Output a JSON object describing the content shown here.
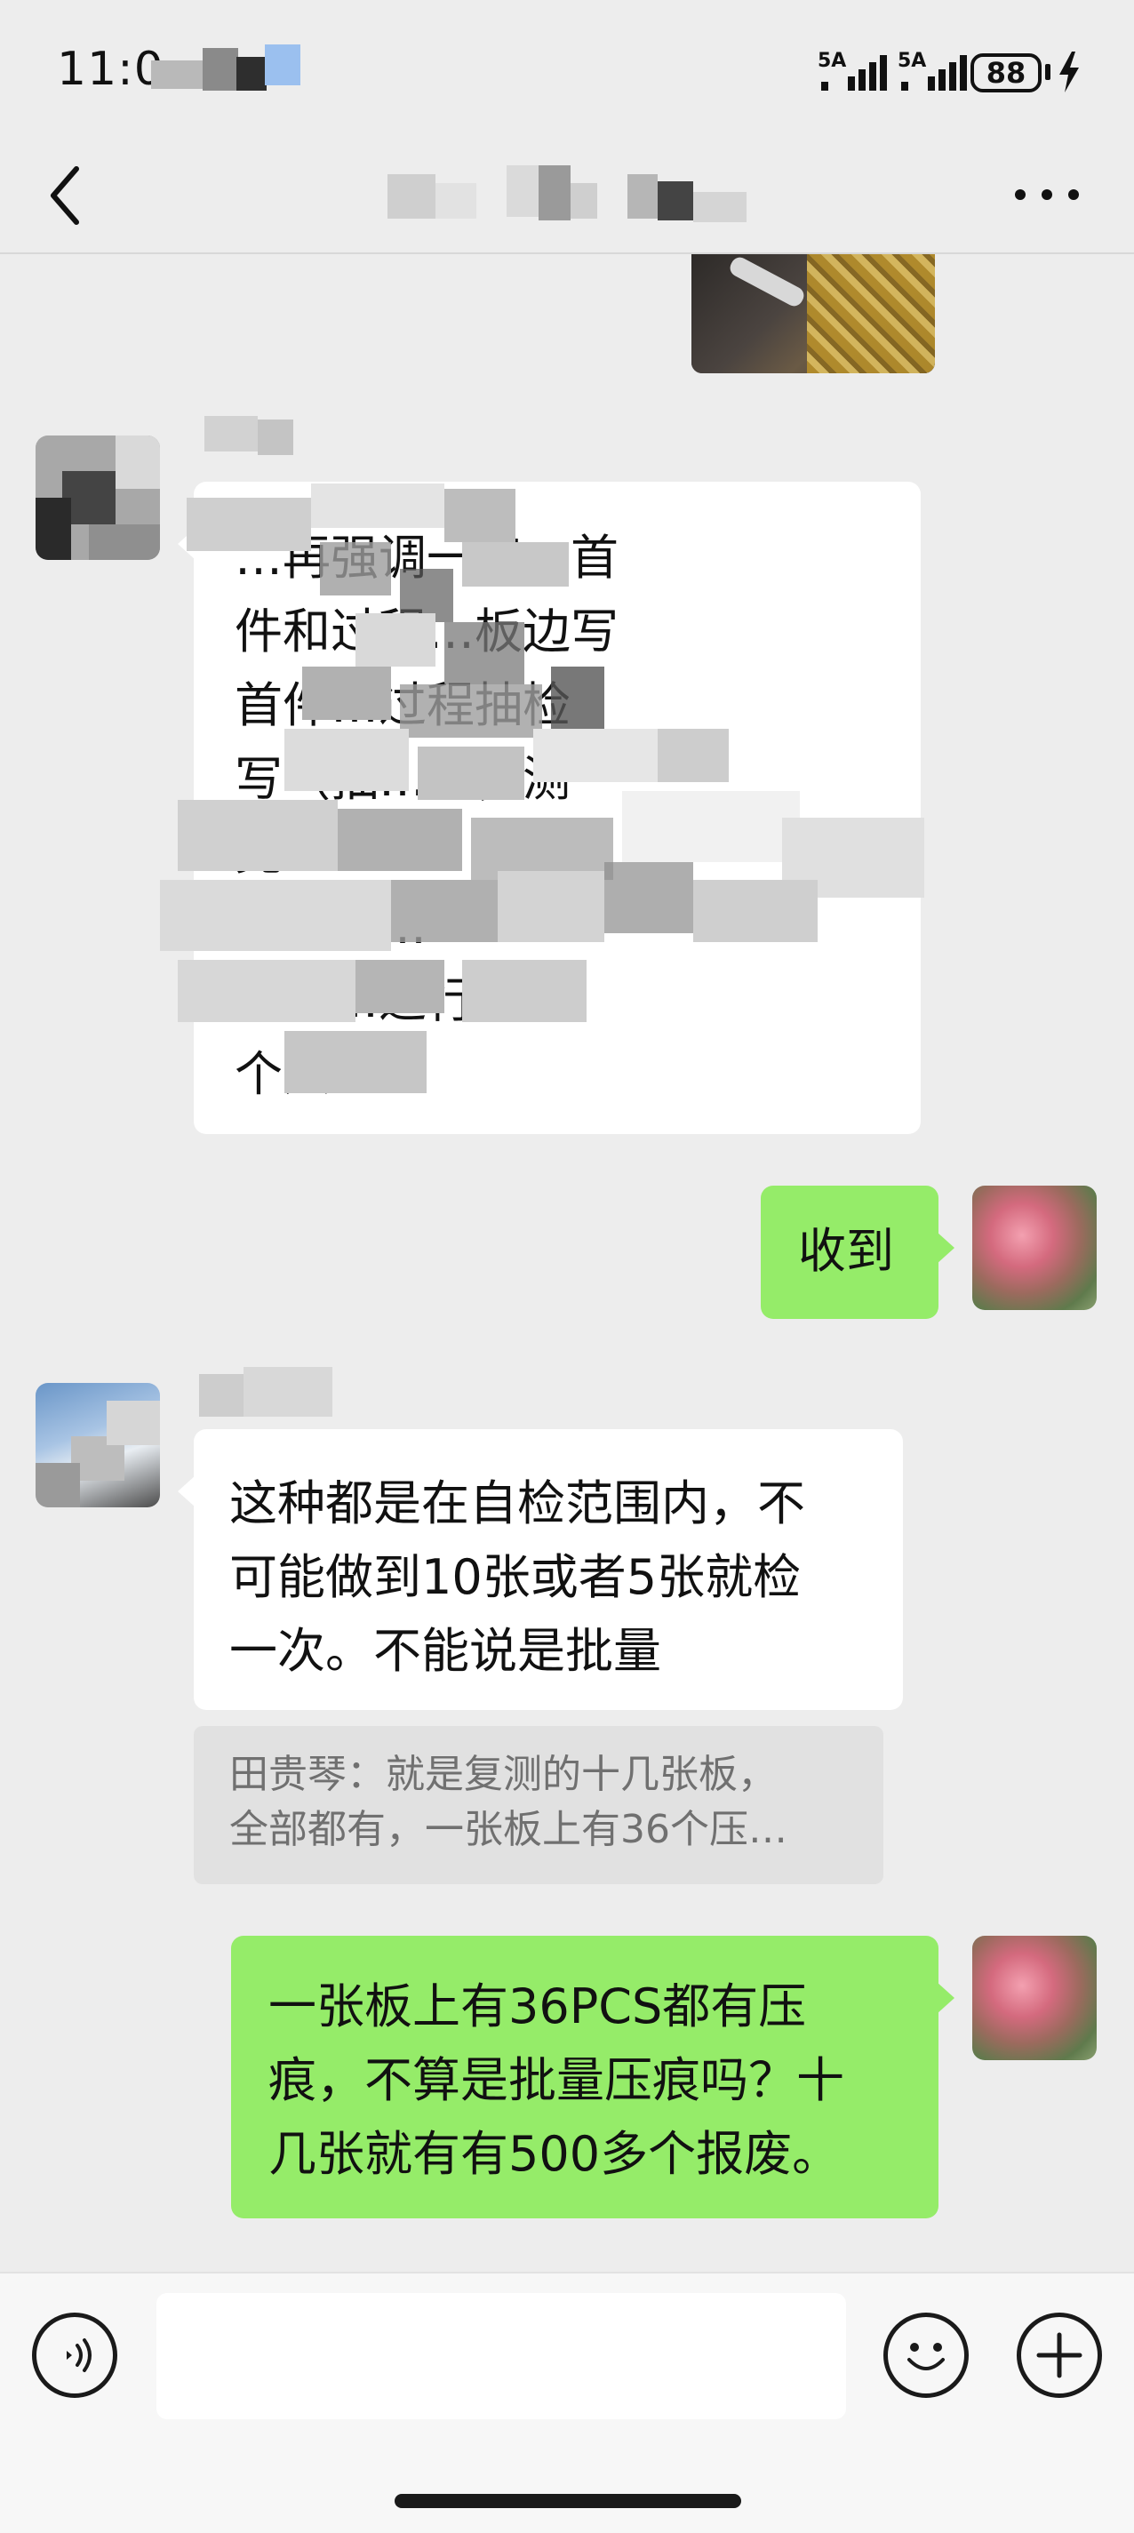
{
  "status_bar": {
    "time": "11:0",
    "signal1_label": "5A",
    "signal2_label": "5A",
    "battery": "88"
  },
  "nav": {
    "back_icon": "chevron-left-icon",
    "more_icon": "more-dots-icon"
  },
  "messages": [
    {
      "id": "m1",
      "direction": "incoming",
      "lines": [
        "…再强调一遍，首",
        "件和过程…板边写",
        "首件…过程抽检",
        "写（抽…置，测",
        "完…",
        "…不定…",
        "…做…进行",
        "个人…"
      ]
    },
    {
      "id": "m2",
      "direction": "outgoing",
      "lines": [
        "收到"
      ]
    },
    {
      "id": "m3",
      "direction": "incoming",
      "lines": [
        "这种都是在自检范围内，不",
        "可能做到10张或者5张就检",
        "一次。不能说是批量"
      ],
      "quote_lines": [
        "田贵琴：就是复测的十几张板，",
        "全部都有，一张板上有36个压…"
      ]
    },
    {
      "id": "m4",
      "direction": "outgoing",
      "lines": [
        "一张板上有36PCS都有压",
        "痕，不算是批量压痕吗？十",
        "几张就有有500多个报废。"
      ]
    }
  ],
  "input_bar": {
    "voice_icon": "voice-icon",
    "emoji_icon": "emoji-icon",
    "add_icon": "plus-circle-icon",
    "placeholder": ""
  },
  "colors": {
    "background": "#ededed",
    "incoming_bubble": "#ffffff",
    "outgoing_bubble": "#95ec69",
    "quote_bg": "#e1e1e1",
    "quote_text": "#707070"
  }
}
